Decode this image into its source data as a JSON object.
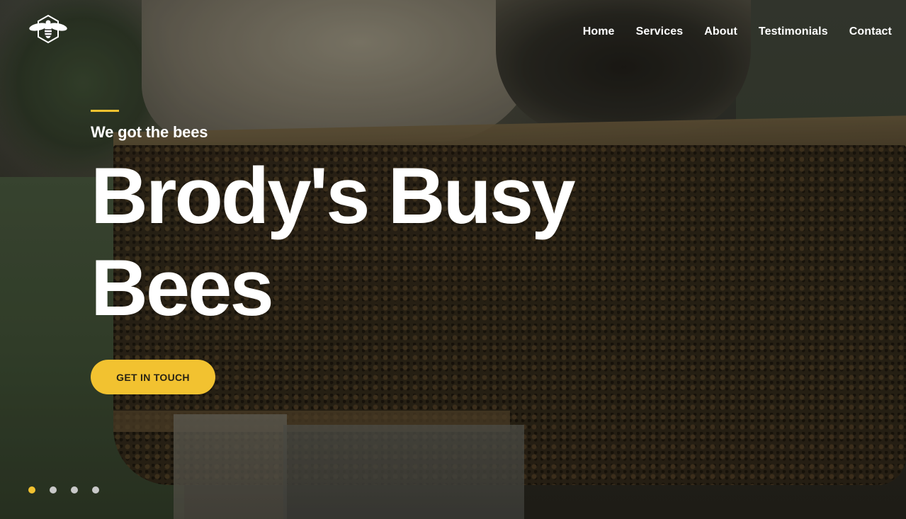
{
  "brand": {
    "logo_icon": "bee-hexagon-icon",
    "accent_color": "#f2c230"
  },
  "nav": {
    "items": [
      {
        "label": "Home"
      },
      {
        "label": "Services"
      },
      {
        "label": "About"
      },
      {
        "label": "Testimonials"
      },
      {
        "label": "Contact"
      }
    ]
  },
  "hero": {
    "tagline": "We got the bees",
    "title": "Brody's Busy Bees",
    "cta_label": "GET IN TOUCH"
  },
  "slider": {
    "slide_count": 4,
    "active_index": 0
  }
}
